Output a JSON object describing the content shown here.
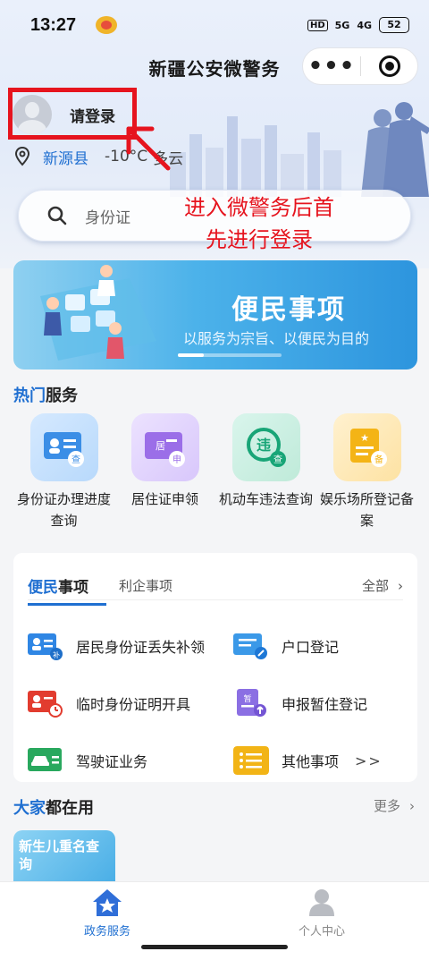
{
  "status_bar": {
    "time": "13:27",
    "hd": "HD",
    "signal_1": "5G",
    "signal_2": "4G",
    "battery": "52"
  },
  "title_bar": {
    "title": "新疆公安微警务",
    "more_icon": "more-dots-icon",
    "close_icon": "target-close-icon"
  },
  "user": {
    "login_label": "请登录",
    "city": "新源县",
    "temperature": "-10°C",
    "weather": "多云"
  },
  "annotation": {
    "text_line1": "进入微警务后首",
    "text_line2": "先进行登录",
    "color": "#e6141e"
  },
  "search": {
    "placeholder": "身份证"
  },
  "banner": {
    "title": "便民事项",
    "subtitle": "以服务为宗旨、以便民为目的",
    "progress": 0.25
  },
  "hot_services": {
    "title_accent": "热门",
    "title_rest": "服务",
    "items": [
      {
        "label": "身份证办理进度查询",
        "icon": "id-card-query-icon"
      },
      {
        "label": "居住证申领",
        "icon": "residence-permit-icon"
      },
      {
        "label": "机动车违法查询",
        "icon": "vehicle-violation-icon"
      },
      {
        "label": "娱乐场所登记备案",
        "icon": "entertainment-record-icon"
      }
    ]
  },
  "convenience": {
    "tab_active_accent": "便民",
    "tab_active_rest": "事项",
    "tab_inactive": "利企事项",
    "all_label": "全部",
    "items": [
      {
        "label": "居民身份证丢失补领",
        "icon": "id-reissue-icon"
      },
      {
        "label": "户口登记",
        "icon": "household-register-icon"
      },
      {
        "label": "临时身份证明开具",
        "icon": "temp-id-icon"
      },
      {
        "label": "申报暂住登记",
        "icon": "temp-residence-icon"
      },
      {
        "label": "驾驶证业务",
        "icon": "driving-license-icon"
      },
      {
        "label": "其他事项",
        "icon": "other-list-icon"
      }
    ],
    "other_arrow": ">>"
  },
  "common_use": {
    "title_accent": "大家",
    "title_rest": "都在用",
    "more_label": "更多",
    "card_text": "新生儿重名查询"
  },
  "bottom_nav": {
    "items": [
      {
        "label": "政务服务",
        "icon": "home-star-icon",
        "active": true
      },
      {
        "label": "个人中心",
        "icon": "person-icon",
        "active": false
      }
    ]
  },
  "colors": {
    "accent": "#1f6fd1",
    "annotation_red": "#e6141e"
  }
}
